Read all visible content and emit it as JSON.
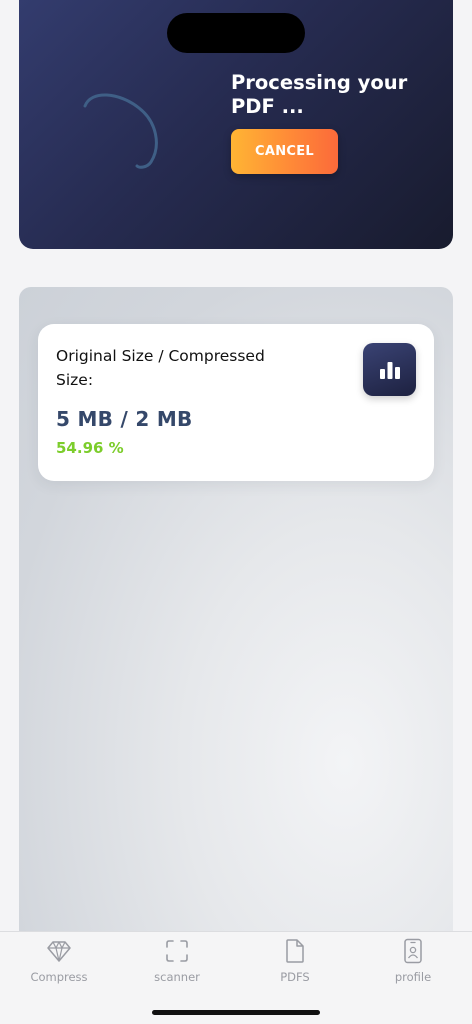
{
  "processing": {
    "title": "Processing your PDF ...",
    "cancel_label": "CANCEL"
  },
  "stats": {
    "label": "Original Size / Compressed Size:",
    "values": "5 MB / 2 MB",
    "percent": "54.96 %"
  },
  "tabs": [
    {
      "label": "Compress",
      "icon": "diamond-icon"
    },
    {
      "label": "scanner",
      "icon": "scan-frame-icon"
    },
    {
      "label": "PDFS",
      "icon": "document-icon"
    },
    {
      "label": "profile",
      "icon": "id-badge-icon"
    }
  ],
  "colors": {
    "hero_bg": "#262b50",
    "cancel_gradient": [
      "#ffb534",
      "#fb6a3a"
    ],
    "size_text": "#35486a",
    "percent_text": "#7ccd2b",
    "tab_inactive": "#9a9ca3"
  }
}
